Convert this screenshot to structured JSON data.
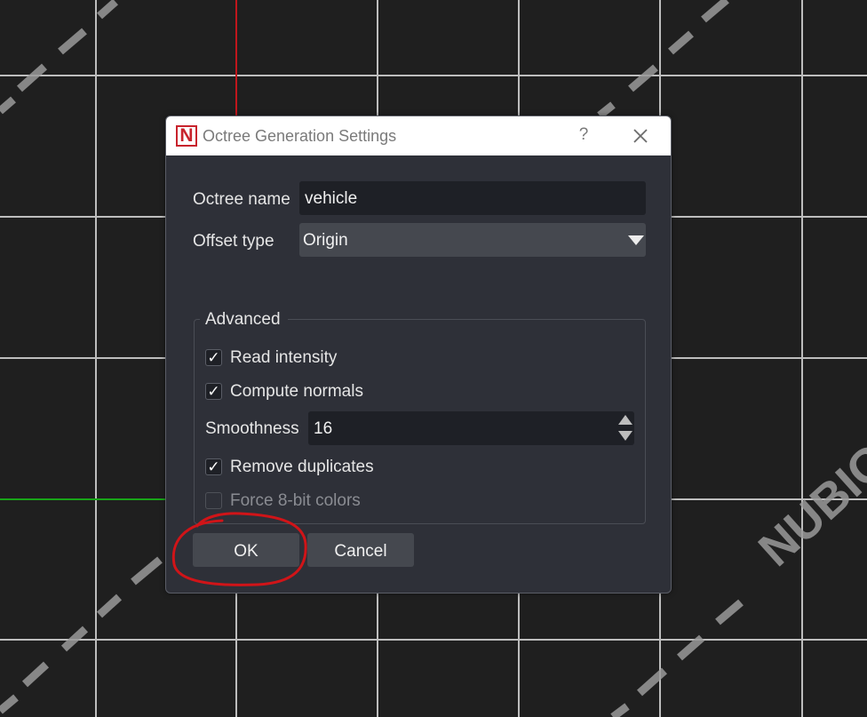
{
  "background": {
    "grid_color": "#bdbdbd",
    "axis_red_color": "#c0161c",
    "axis_green_color": "#18a418",
    "watermark_text": "— NUBIGON —"
  },
  "dialog": {
    "title": "Octree Generation Settings",
    "logo_letter": "N",
    "help_label": "?",
    "octree_name_label": "Octree name",
    "octree_name_value": "vehicle",
    "offset_type_label": "Offset type",
    "offset_type_value": "Origin",
    "advanced_group_title": "Advanced",
    "read_intensity_label": "Read intensity",
    "read_intensity_checked": true,
    "compute_normals_label": "Compute normals",
    "compute_normals_checked": true,
    "smoothness_label": "Smoothness",
    "smoothness_value": "16",
    "remove_duplicates_label": "Remove duplicates",
    "remove_duplicates_checked": true,
    "force_8bit_label": "Force 8-bit colors",
    "force_8bit_checked": false,
    "force_8bit_enabled": false,
    "ok_label": "OK",
    "cancel_label": "Cancel",
    "accent_color": "#c8232c",
    "annotation_color": "#d01418"
  }
}
